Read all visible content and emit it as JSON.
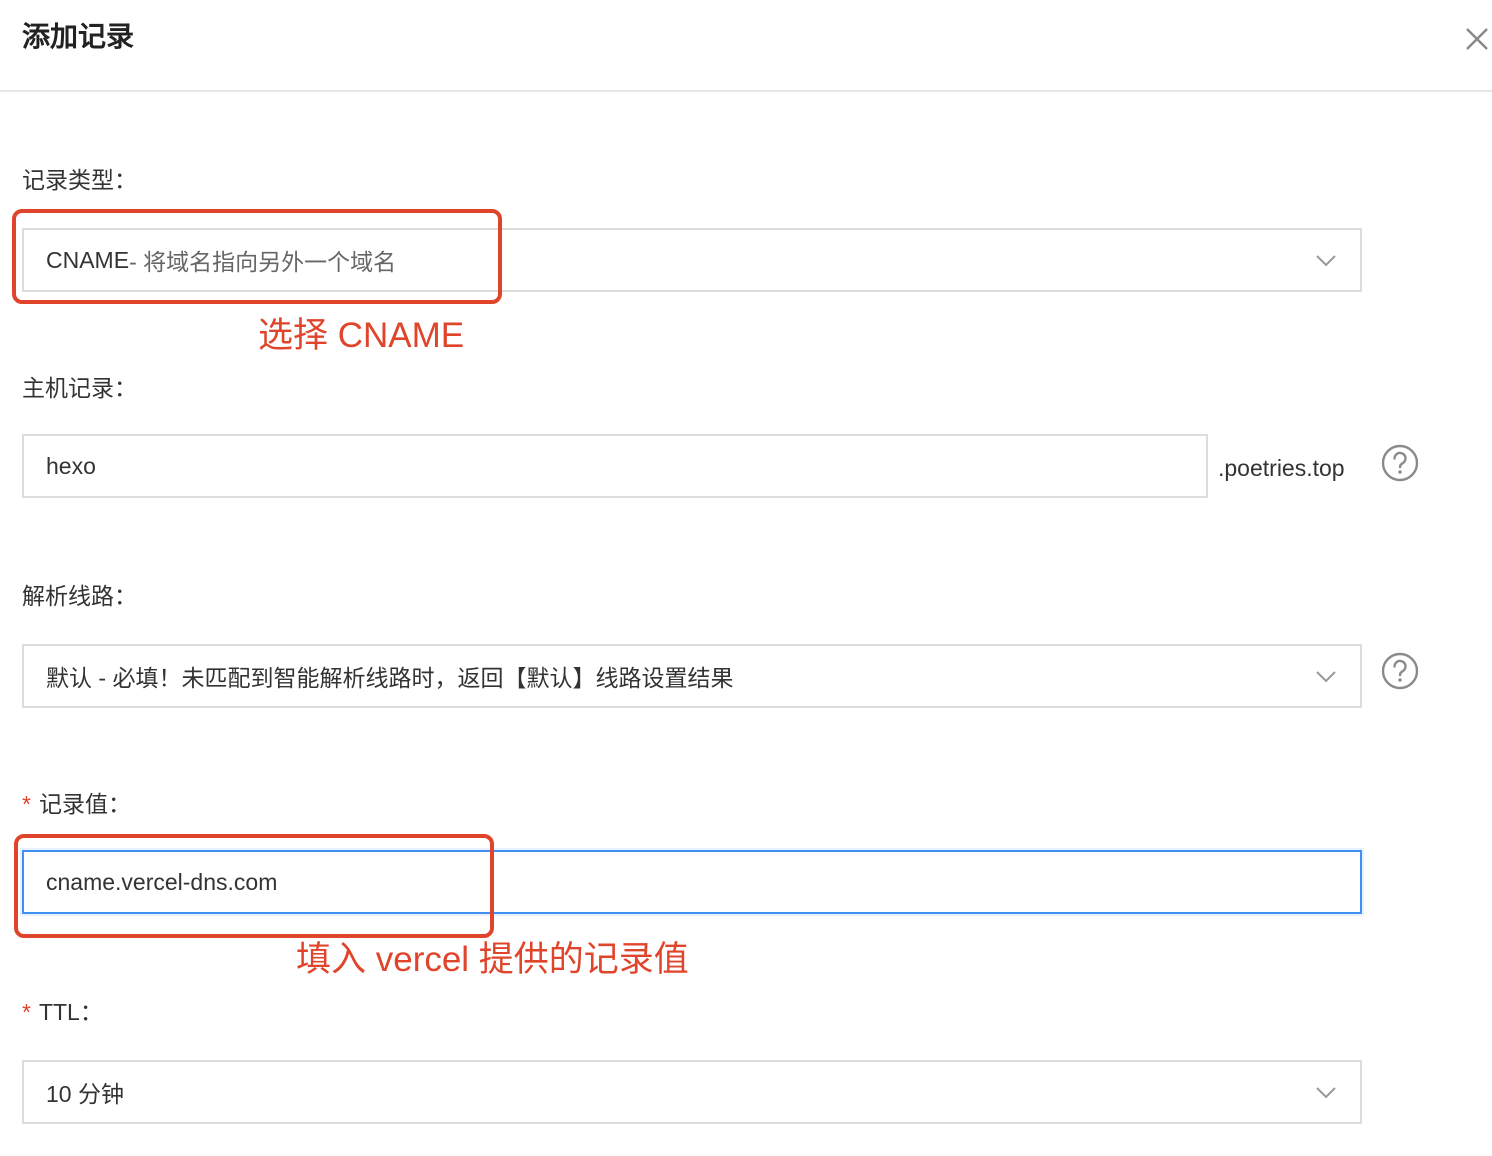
{
  "dialog": {
    "title": "添加记录",
    "close_icon": "close-icon"
  },
  "record_type": {
    "label": "记录类型：",
    "value_main": "CNAME",
    "value_sub": "- 将域名指向另外一个域名",
    "icon": "chevron-down-icon"
  },
  "host": {
    "label": "主机记录：",
    "value": "hexo",
    "suffix": ".poetries.top",
    "help_icon": "question-circle-icon"
  },
  "line": {
    "label": "解析线路：",
    "value": "默认 - 必填！未匹配到智能解析线路时，返回【默认】线路设置结果",
    "icon": "chevron-down-icon",
    "help_icon": "question-circle-icon"
  },
  "record_value": {
    "required_mark": "*",
    "label": "记录值：",
    "value": "cname.vercel-dns.com"
  },
  "ttl": {
    "required_mark": "*",
    "label": "TTL：",
    "value": "10 分钟",
    "icon": "chevron-down-icon"
  },
  "annotations": {
    "select_cname": "选择 CNAME",
    "fill_value": "填入 vercel 提供的记录值",
    "color": "#e0452c"
  },
  "colors": {
    "focus_border": "#3f8ff5",
    "required": "#e0452c",
    "field_border": "#dcdcdc"
  }
}
